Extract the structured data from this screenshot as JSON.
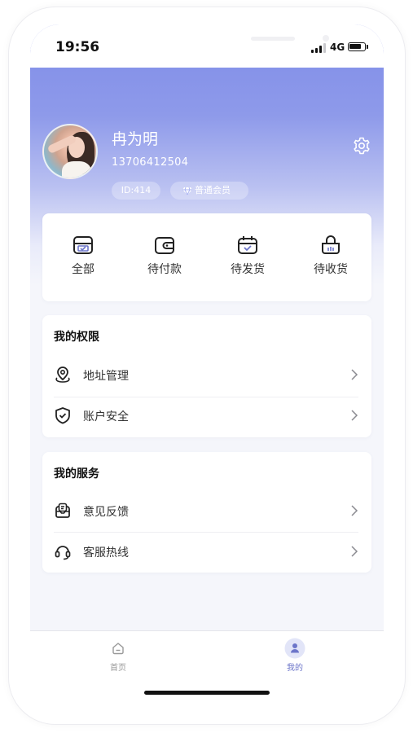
{
  "status_bar": {
    "time": "19:56",
    "network": "4G"
  },
  "profile": {
    "name": "冉为明",
    "phone": "13706412504",
    "id_badge": "ID:414",
    "member_badge": "普通会员"
  },
  "orders": [
    {
      "label": "全部",
      "icon": "all-orders-icon"
    },
    {
      "label": "待付款",
      "icon": "wallet-icon"
    },
    {
      "label": "待发货",
      "icon": "calendar-check-icon"
    },
    {
      "label": "待收货",
      "icon": "shopping-bag-icon"
    }
  ],
  "permissions": {
    "title": "我的权限",
    "items": [
      {
        "label": "地址管理",
        "icon": "location-pin-icon"
      },
      {
        "label": "账户安全",
        "icon": "shield-check-icon"
      }
    ]
  },
  "services": {
    "title": "我的服务",
    "items": [
      {
        "label": "意见反馈",
        "icon": "feedback-icon"
      },
      {
        "label": "客服热线",
        "icon": "headset-icon"
      }
    ]
  },
  "tabbar": {
    "items": [
      {
        "label": "首页",
        "icon": "home-icon",
        "active": false
      },
      {
        "label": "我的",
        "icon": "user-icon",
        "active": true
      }
    ]
  },
  "colors": {
    "header_gradient_top": "#7f8ce8",
    "accent": "#6c75c9",
    "background": "#f5f6fb"
  }
}
